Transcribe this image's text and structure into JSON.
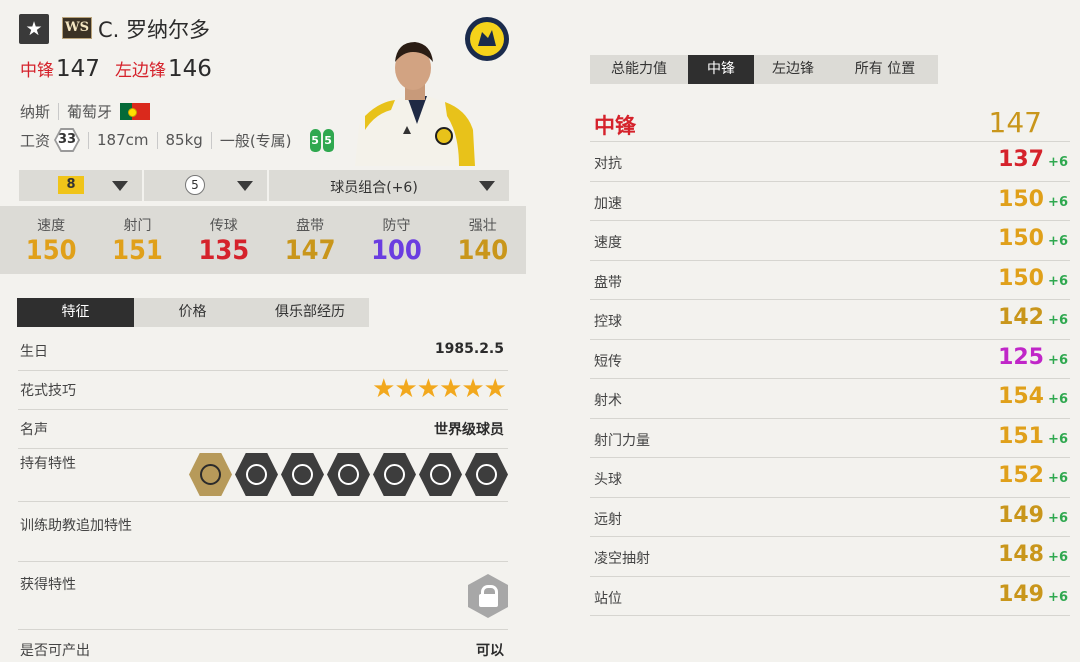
{
  "header": {
    "favorite_icon": "star-icon",
    "season_badge": "WS",
    "player_name": "C. 罗纳尔多",
    "positions": [
      {
        "label": "中锋",
        "value": "147"
      },
      {
        "label": "左边锋",
        "value": "146"
      }
    ],
    "club": "纳斯",
    "nation": "葡萄牙",
    "flag_icon": "portugal-flag-icon",
    "salary_label": "工资",
    "salary": "33",
    "height": "187cm",
    "weight": "85kg",
    "body_type": "一般(专属)",
    "weak_foot_left": "5",
    "weak_foot_right": "5"
  },
  "selectors": {
    "grade": "8",
    "level": "5",
    "combo": "球员组合(+6)"
  },
  "stats": [
    {
      "label": "速度",
      "value": "150",
      "color": "#e0a01a"
    },
    {
      "label": "射门",
      "value": "151",
      "color": "#e0a01a"
    },
    {
      "label": "传球",
      "value": "135",
      "color": "#d5222b"
    },
    {
      "label": "盘带",
      "value": "147",
      "color": "#c9961b"
    },
    {
      "label": "防守",
      "value": "100",
      "color": "#6a3de0"
    },
    {
      "label": "强壮",
      "value": "140",
      "color": "#c9961b"
    }
  ],
  "left_tabs": [
    "特征",
    "价格",
    "俱乐部经历"
  ],
  "details": {
    "birthday_label": "生日",
    "birthday": "1985.2.5",
    "skill_label": "花式技巧",
    "skill_stars": "★★★★★★",
    "fame_label": "名声",
    "fame": "世界级球员",
    "traits_label": "持有特性",
    "traits": [
      "trait-1-icon",
      "trait-2-icon",
      "trait-3-icon",
      "trait-4-icon",
      "trait-5-icon",
      "trait-6-icon",
      "trait-7-icon"
    ],
    "coach_label": "训练助教追加特性",
    "acquire_label": "获得特性",
    "produce_label": "是否可产出",
    "produce": "可以"
  },
  "right_tabs": [
    "总能力值",
    "中锋",
    "左边锋",
    "所有 位置"
  ],
  "position_overall": {
    "label": "中锋",
    "value": "147"
  },
  "attributes": [
    {
      "label": "对抗",
      "value": "137",
      "bonus": "+6",
      "color": "#d5222b"
    },
    {
      "label": "加速",
      "value": "150",
      "bonus": "+6",
      "color": "#e0a01a"
    },
    {
      "label": "速度",
      "value": "150",
      "bonus": "+6",
      "color": "#e0a01a"
    },
    {
      "label": "盘带",
      "value": "150",
      "bonus": "+6",
      "color": "#e0a01a"
    },
    {
      "label": "控球",
      "value": "142",
      "bonus": "+6",
      "color": "#c9961b"
    },
    {
      "label": "短传",
      "value": "125",
      "bonus": "+6",
      "color": "#c026c8"
    },
    {
      "label": "射术",
      "value": "154",
      "bonus": "+6",
      "color": "#e0a01a"
    },
    {
      "label": "射门力量",
      "value": "151",
      "bonus": "+6",
      "color": "#e0a01a"
    },
    {
      "label": "头球",
      "value": "152",
      "bonus": "+6",
      "color": "#e0a01a"
    },
    {
      "label": "远射",
      "value": "149",
      "bonus": "+6",
      "color": "#c9961b"
    },
    {
      "label": "凌空抽射",
      "value": "148",
      "bonus": "+6",
      "color": "#c9961b"
    },
    {
      "label": "站位",
      "value": "149",
      "bonus": "+6",
      "color": "#c9961b"
    }
  ]
}
